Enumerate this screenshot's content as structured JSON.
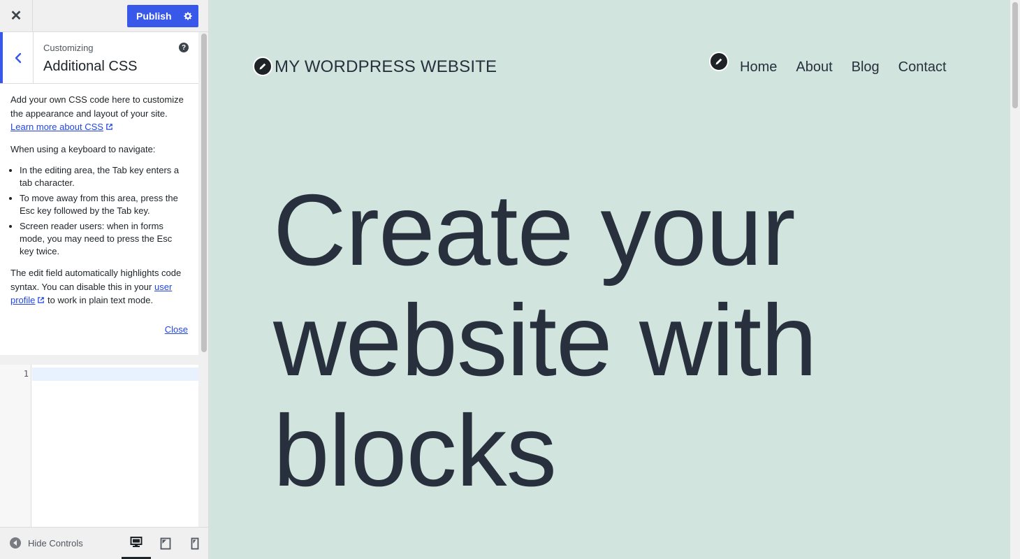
{
  "topbar": {
    "close_symbol": "✕",
    "publish_label": "Publish"
  },
  "section": {
    "crumb": "Customizing",
    "title": "Additional CSS",
    "help_symbol": "?"
  },
  "description": {
    "intro": "Add your own CSS code here to customize the appearance and layout of your site.",
    "learn_more_link": "Learn more about CSS",
    "keyboard_heading": "When using a keyboard to navigate:",
    "bullets": [
      "In the editing area, the Tab key enters a tab character.",
      "To move away from this area, press the Esc key followed by the Tab key.",
      "Screen reader users: when in forms mode, you may need to press the Esc key twice."
    ],
    "highlight_text_before": "The edit field automatically highlights code syntax. You can disable this in your",
    "user_profile_link": "user profile",
    "highlight_text_after": "to work in plain text mode.",
    "close_link": "Close"
  },
  "editor": {
    "line_number": "1",
    "content": ""
  },
  "footer": {
    "hide_controls": "Hide Controls"
  },
  "preview": {
    "site_title": "MY WORDPRESS WEBSITE",
    "nav": [
      "Home",
      "About",
      "Blog",
      "Contact"
    ],
    "hero": "Create your website with blocks"
  },
  "colors": {
    "accent": "#3858e9",
    "preview_bg": "#d1e4dd",
    "text_dark": "#28303d",
    "link": "#2145e6"
  },
  "icons": [
    "close-icon",
    "gear-icon",
    "chevron-left-icon",
    "help-icon",
    "external-link-icon",
    "arrow-left-circle-icon",
    "desktop-icon",
    "tablet-icon",
    "mobile-icon",
    "pencil-icon"
  ]
}
